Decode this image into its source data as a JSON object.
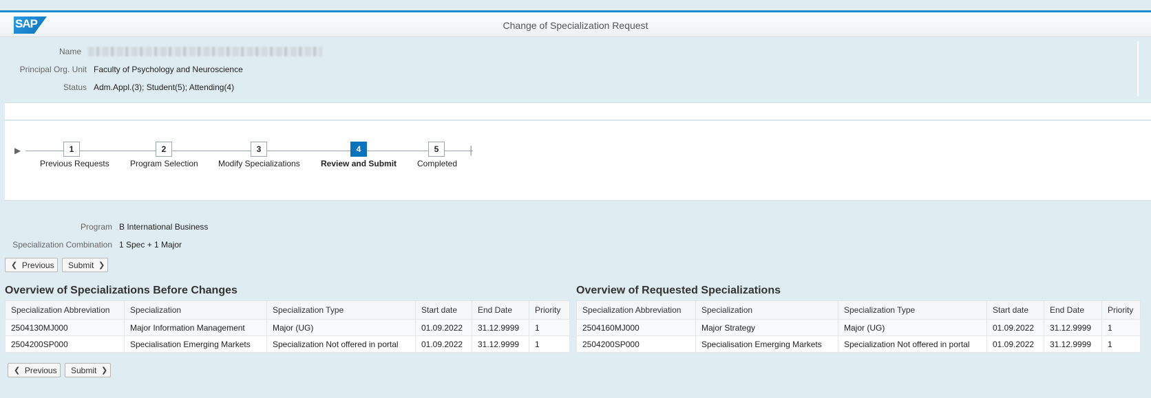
{
  "header": {
    "logo_text": "SAP",
    "title": "Change of Specialization Request"
  },
  "person": {
    "name_label": "Name",
    "org_label": "Principal Org. Unit",
    "org_value": "Faculty of Psychology and Neuroscience",
    "status_label": "Status",
    "status_value": "Adm.Appl.(3); Student(5); Attending(4)"
  },
  "roadmap": {
    "steps": [
      {
        "number": "1",
        "label": "Previous Requests"
      },
      {
        "number": "2",
        "label": "Program Selection"
      },
      {
        "number": "3",
        "label": "Modify Specializations"
      },
      {
        "number": "4",
        "label": "Review and Submit"
      },
      {
        "number": "5",
        "label": "Completed"
      }
    ],
    "active_step": "4"
  },
  "program": {
    "program_label": "Program",
    "program_value": "B International Business",
    "combo_label": "Specialization Combination",
    "combo_value": "1 Spec + 1 Major"
  },
  "buttons": {
    "previous": "Previous",
    "submit": "Submit"
  },
  "columns": [
    "Specialization Abbreviation",
    "Specialization",
    "Specialization Type",
    "Start date",
    "End Date",
    "Priority"
  ],
  "before": {
    "title": "Overview of Specializations Before Changes",
    "rows": [
      [
        "2504130MJ000",
        "Major Information Management",
        "Major (UG)",
        "01.09.2022",
        "31.12.9999",
        "1"
      ],
      [
        "2504200SP000",
        "Specialisation Emerging Markets",
        "Specialization Not offered in portal",
        "01.09.2022",
        "31.12.9999",
        "1"
      ]
    ]
  },
  "requested": {
    "title": "Overview of Requested Specializations",
    "rows": [
      [
        "2504160MJ000",
        "Major Strategy",
        "Major (UG)",
        "01.09.2022",
        "31.12.9999",
        "1"
      ],
      [
        "2504200SP000",
        "Specialisation Emerging Markets",
        "Specialization Not offered in portal",
        "01.09.2022",
        "31.12.9999",
        "1"
      ]
    ]
  },
  "colors": {
    "accent": "#0a73bd",
    "top_bar": "#1b8dcf",
    "background": "#dfecf1"
  }
}
